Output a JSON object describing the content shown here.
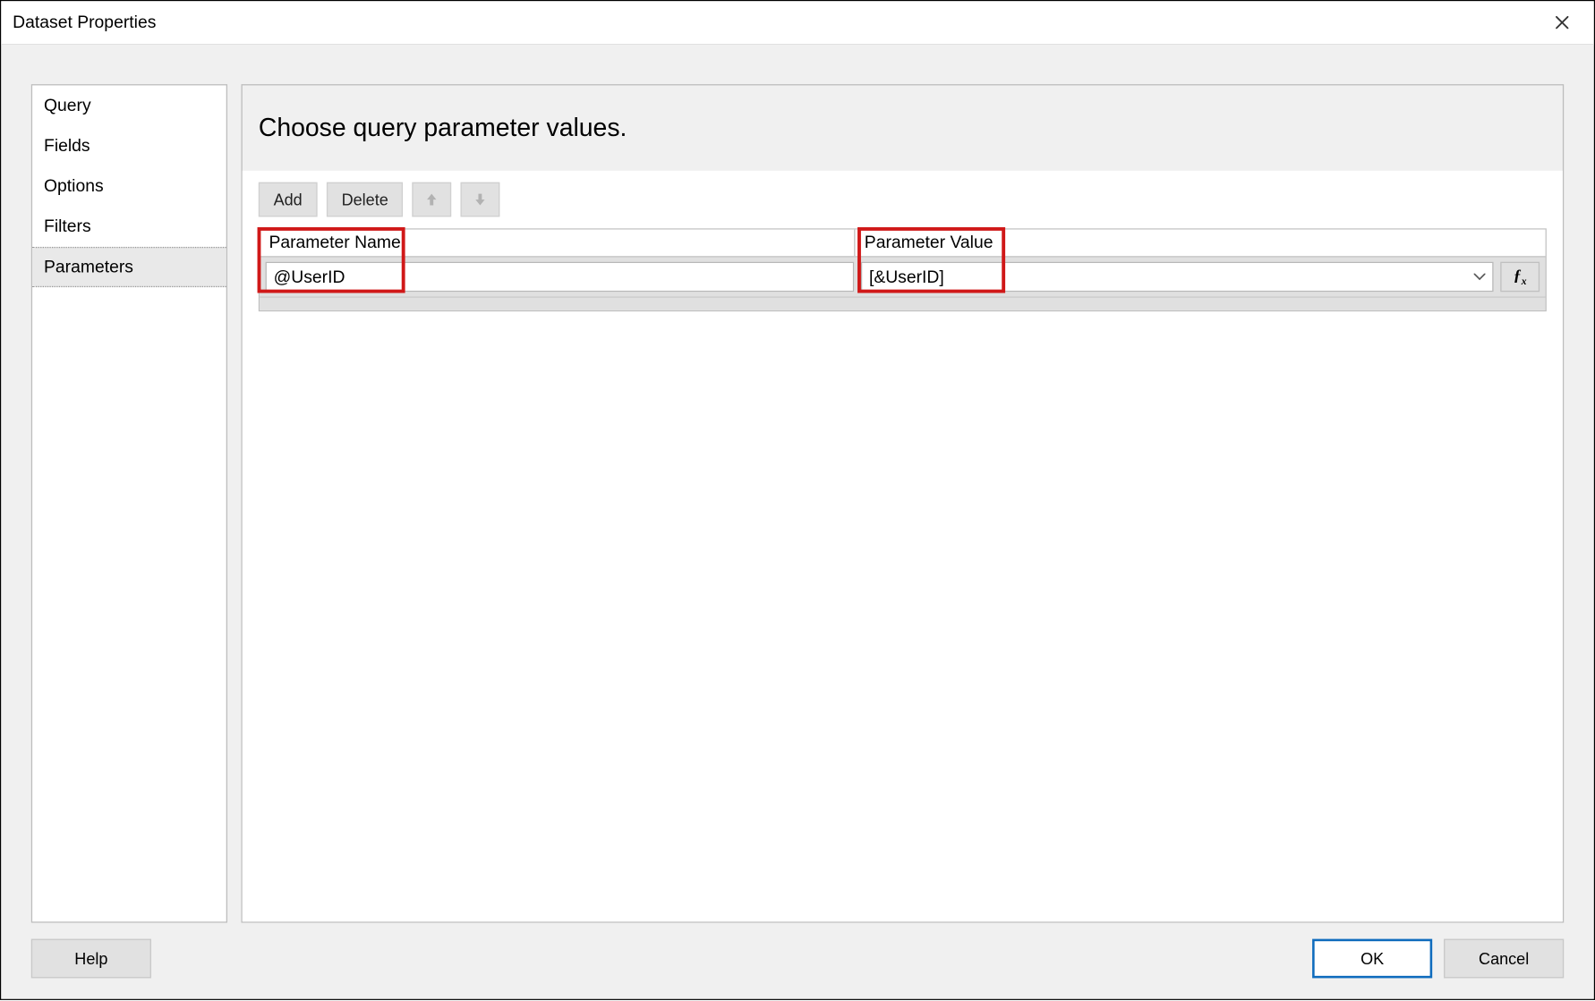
{
  "window": {
    "title": "Dataset Properties"
  },
  "sidebar": {
    "items": [
      {
        "label": "Query"
      },
      {
        "label": "Fields"
      },
      {
        "label": "Options"
      },
      {
        "label": "Filters"
      },
      {
        "label": "Parameters"
      }
    ],
    "selected_index": 4
  },
  "main": {
    "heading": "Choose query parameter values.",
    "toolbar": {
      "add_label": "Add",
      "delete_label": "Delete"
    },
    "table": {
      "header_name": "Parameter Name",
      "header_value": "Parameter Value",
      "rows": [
        {
          "name": "@UserID",
          "value": "[&UserID]"
        }
      ]
    }
  },
  "buttons": {
    "help": "Help",
    "ok": "OK",
    "cancel": "Cancel"
  }
}
